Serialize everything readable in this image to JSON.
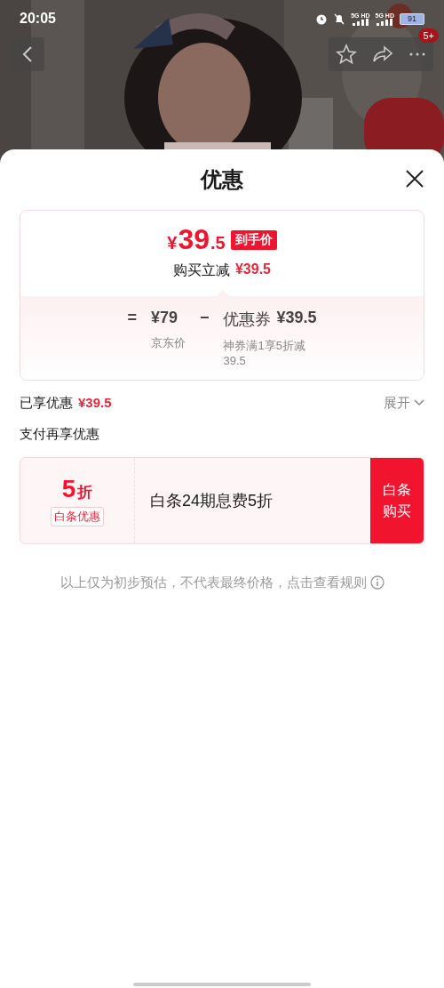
{
  "status_bar": {
    "time": "20:05",
    "network_labels": [
      "5G HD",
      "5G HD"
    ],
    "battery": "91"
  },
  "header": {
    "kind": "picture",
    "more_badge": "5+"
  },
  "sheet": {
    "title": "优惠",
    "price": {
      "currency": "¥",
      "integer": "39",
      "decimal": ".5",
      "tag": "到手价"
    },
    "reduction": {
      "label": "购买立减",
      "amount": "¥39.5"
    },
    "formula": [
      {
        "kind": "operator",
        "text": "="
      },
      {
        "kind": "term",
        "value": "¥79",
        "caption": "京东价"
      },
      {
        "kind": "operator",
        "text": "−"
      },
      {
        "kind": "term",
        "label": "优惠券",
        "value": "¥39.5",
        "caption": "神券满1享5折减39.5"
      }
    ],
    "enjoyed": {
      "label": "已享优惠",
      "amount": "¥39.5",
      "expand": "展开"
    },
    "pay_title": "支付再享优惠",
    "offers": [
      {
        "discount": "5",
        "unit": "折",
        "tag": "白条优惠",
        "description": "白条24期息费5折",
        "action": "白条购买"
      }
    ],
    "note": "以上仅为初步预估，不代表最终价格，点击查看规则"
  }
}
